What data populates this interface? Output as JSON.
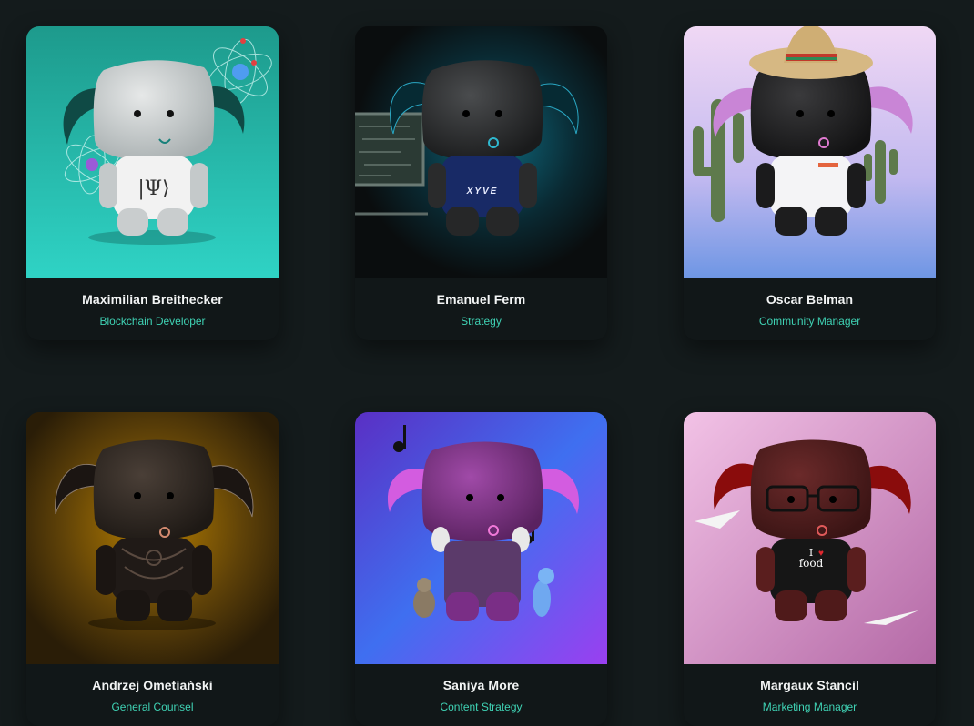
{
  "team": [
    {
      "name": "Maximilian Breithecker",
      "role": "Blockchain Developer",
      "avatar_icon": "character-scientist-icon",
      "background_color": "#25b9a5"
    },
    {
      "name": "Emanuel Ferm",
      "role": "Strategy",
      "avatar_icon": "character-strategy-icon",
      "background_color": "#0b2a30",
      "shirt_text": "XYVE"
    },
    {
      "name": "Oscar Belman",
      "role": "Community Manager",
      "avatar_icon": "character-sombrero-icon",
      "background_color": "#b9b8f0"
    },
    {
      "name": "Andrzej Ometiański",
      "role": "General Counsel",
      "avatar_icon": "character-tattoo-icon",
      "background_color": "#6a4a05"
    },
    {
      "name": "Saniya More",
      "role": "Content Strategy",
      "avatar_icon": "character-music-icon",
      "background_color": "#4c54e0"
    },
    {
      "name": "Margaux Stancil",
      "role": "Marketing Manager",
      "avatar_icon": "character-food-icon",
      "background_color": "#cf8dbd",
      "shirt_text_top": "I",
      "shirt_text_bottom": "food"
    }
  ],
  "colors": {
    "page_bg": "#141b1c",
    "card_bg": "#111718",
    "name_text": "#f2f4f4",
    "role_text": "#3fd2b4"
  }
}
